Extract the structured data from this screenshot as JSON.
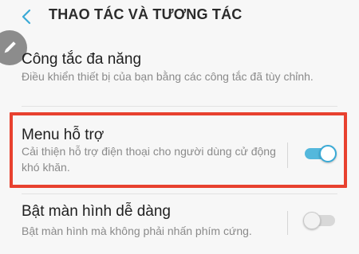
{
  "header": {
    "title": "THAO TÁC VÀ TƯƠNG TÁC"
  },
  "items": [
    {
      "label": "Công tắc đa năng",
      "description": "Điều khiển thiết bị của bạn bằng các công tắc đã tùy chỉnh."
    },
    {
      "label": "Menu hỗ trợ",
      "description": "Cải thiện hỗ trợ điện thoại cho người dùng cử động khó khăn.",
      "toggle_on": true
    },
    {
      "label": "Bật màn hình dễ dàng",
      "description": "Bật màn hình mà không phải nhấn phím cứng.",
      "toggle_on": false
    }
  ],
  "colors": {
    "accent": "#54b8dc",
    "highlight": "#e8412f",
    "edit_button": "#8c8c8c",
    "back_arrow": "#3aaad6"
  },
  "icons": {
    "back": "chevron-left-icon",
    "edit": "pencil-icon"
  }
}
